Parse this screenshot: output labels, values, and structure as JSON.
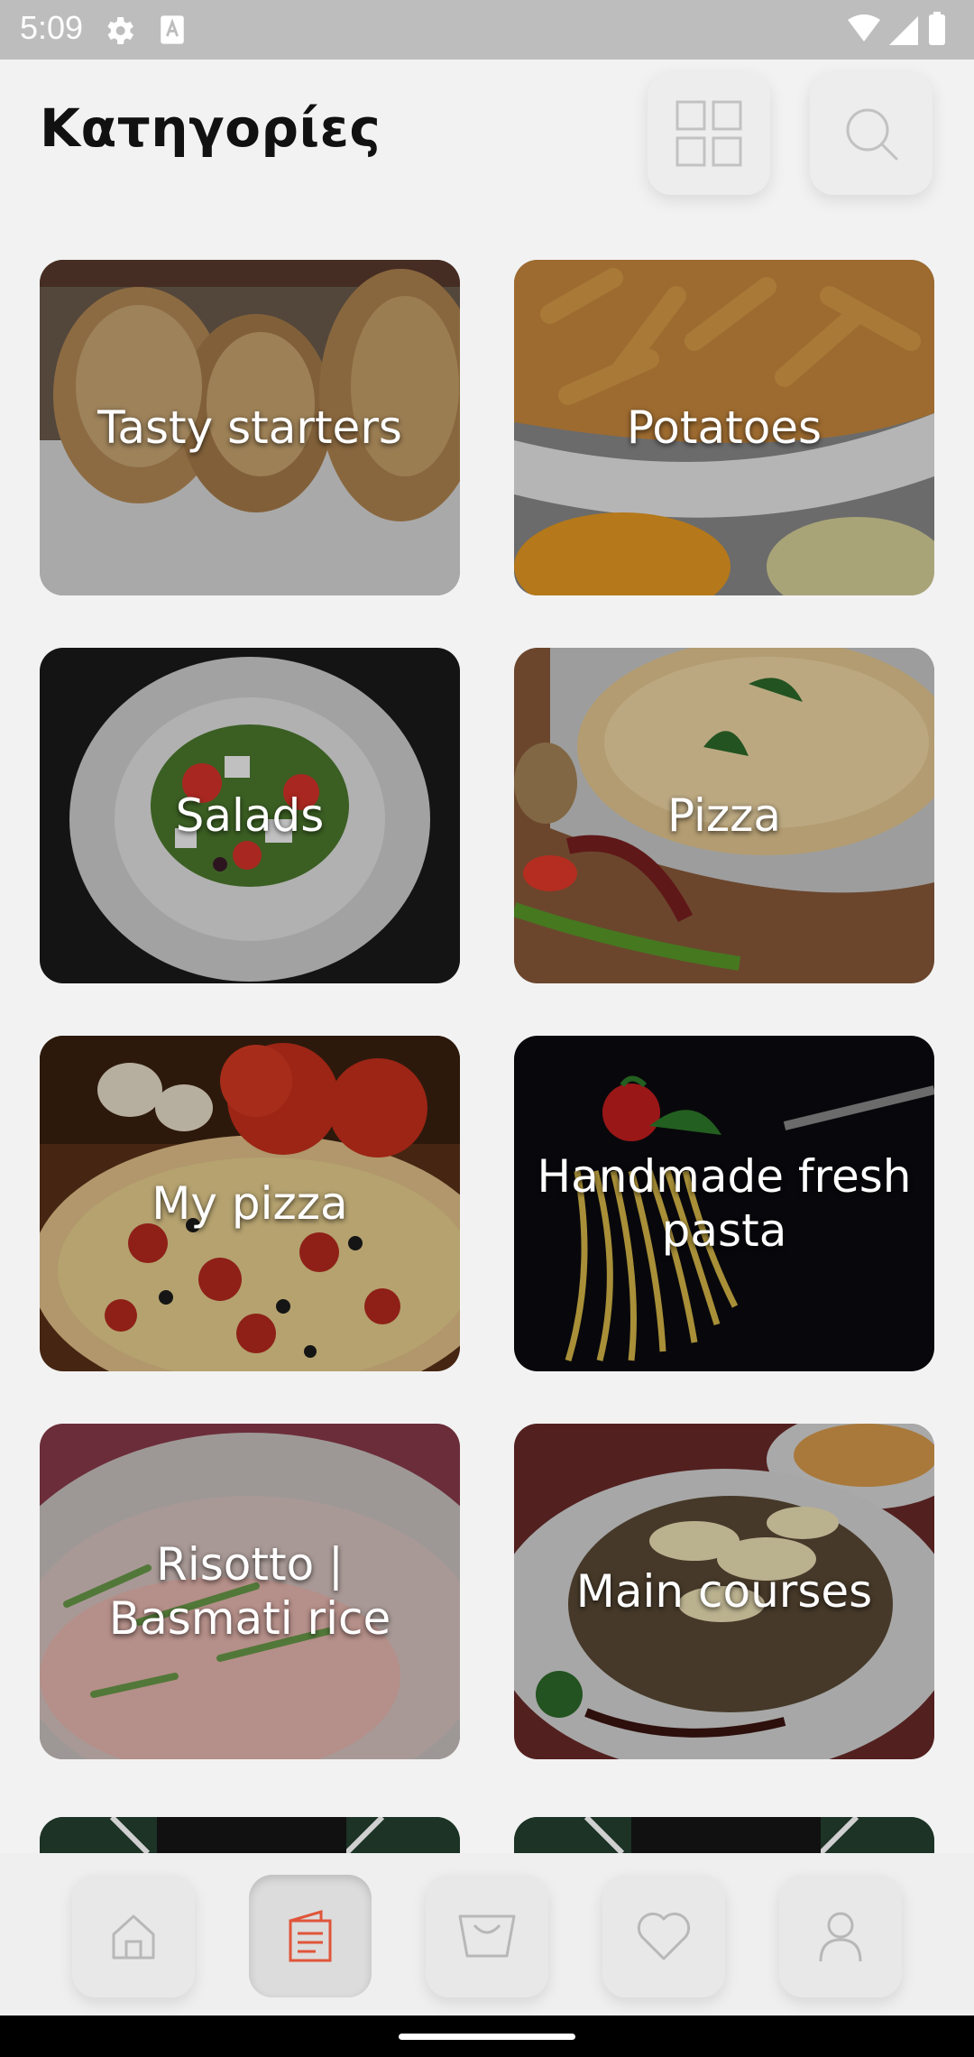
{
  "status_bar": {
    "time": "5:09"
  },
  "header": {
    "title": "Κατηγορίες"
  },
  "categories": [
    {
      "label": "Tasty starters"
    },
    {
      "label": "Potatoes"
    },
    {
      "label": "Salads"
    },
    {
      "label": "Pizza"
    },
    {
      "label": "My pizza"
    },
    {
      "label": "Handmade fresh pasta"
    },
    {
      "label": "Risotto |  Basmati rice"
    },
    {
      "label": "Main courses"
    }
  ],
  "nav": {
    "items": [
      {
        "icon": "home-icon"
      },
      {
        "icon": "menu-icon",
        "active": true
      },
      {
        "icon": "basket-icon"
      },
      {
        "icon": "heart-icon"
      },
      {
        "icon": "user-icon"
      }
    ]
  },
  "colors": {
    "accent": "#e0553a",
    "icon_gray": "#b8b8b8"
  }
}
